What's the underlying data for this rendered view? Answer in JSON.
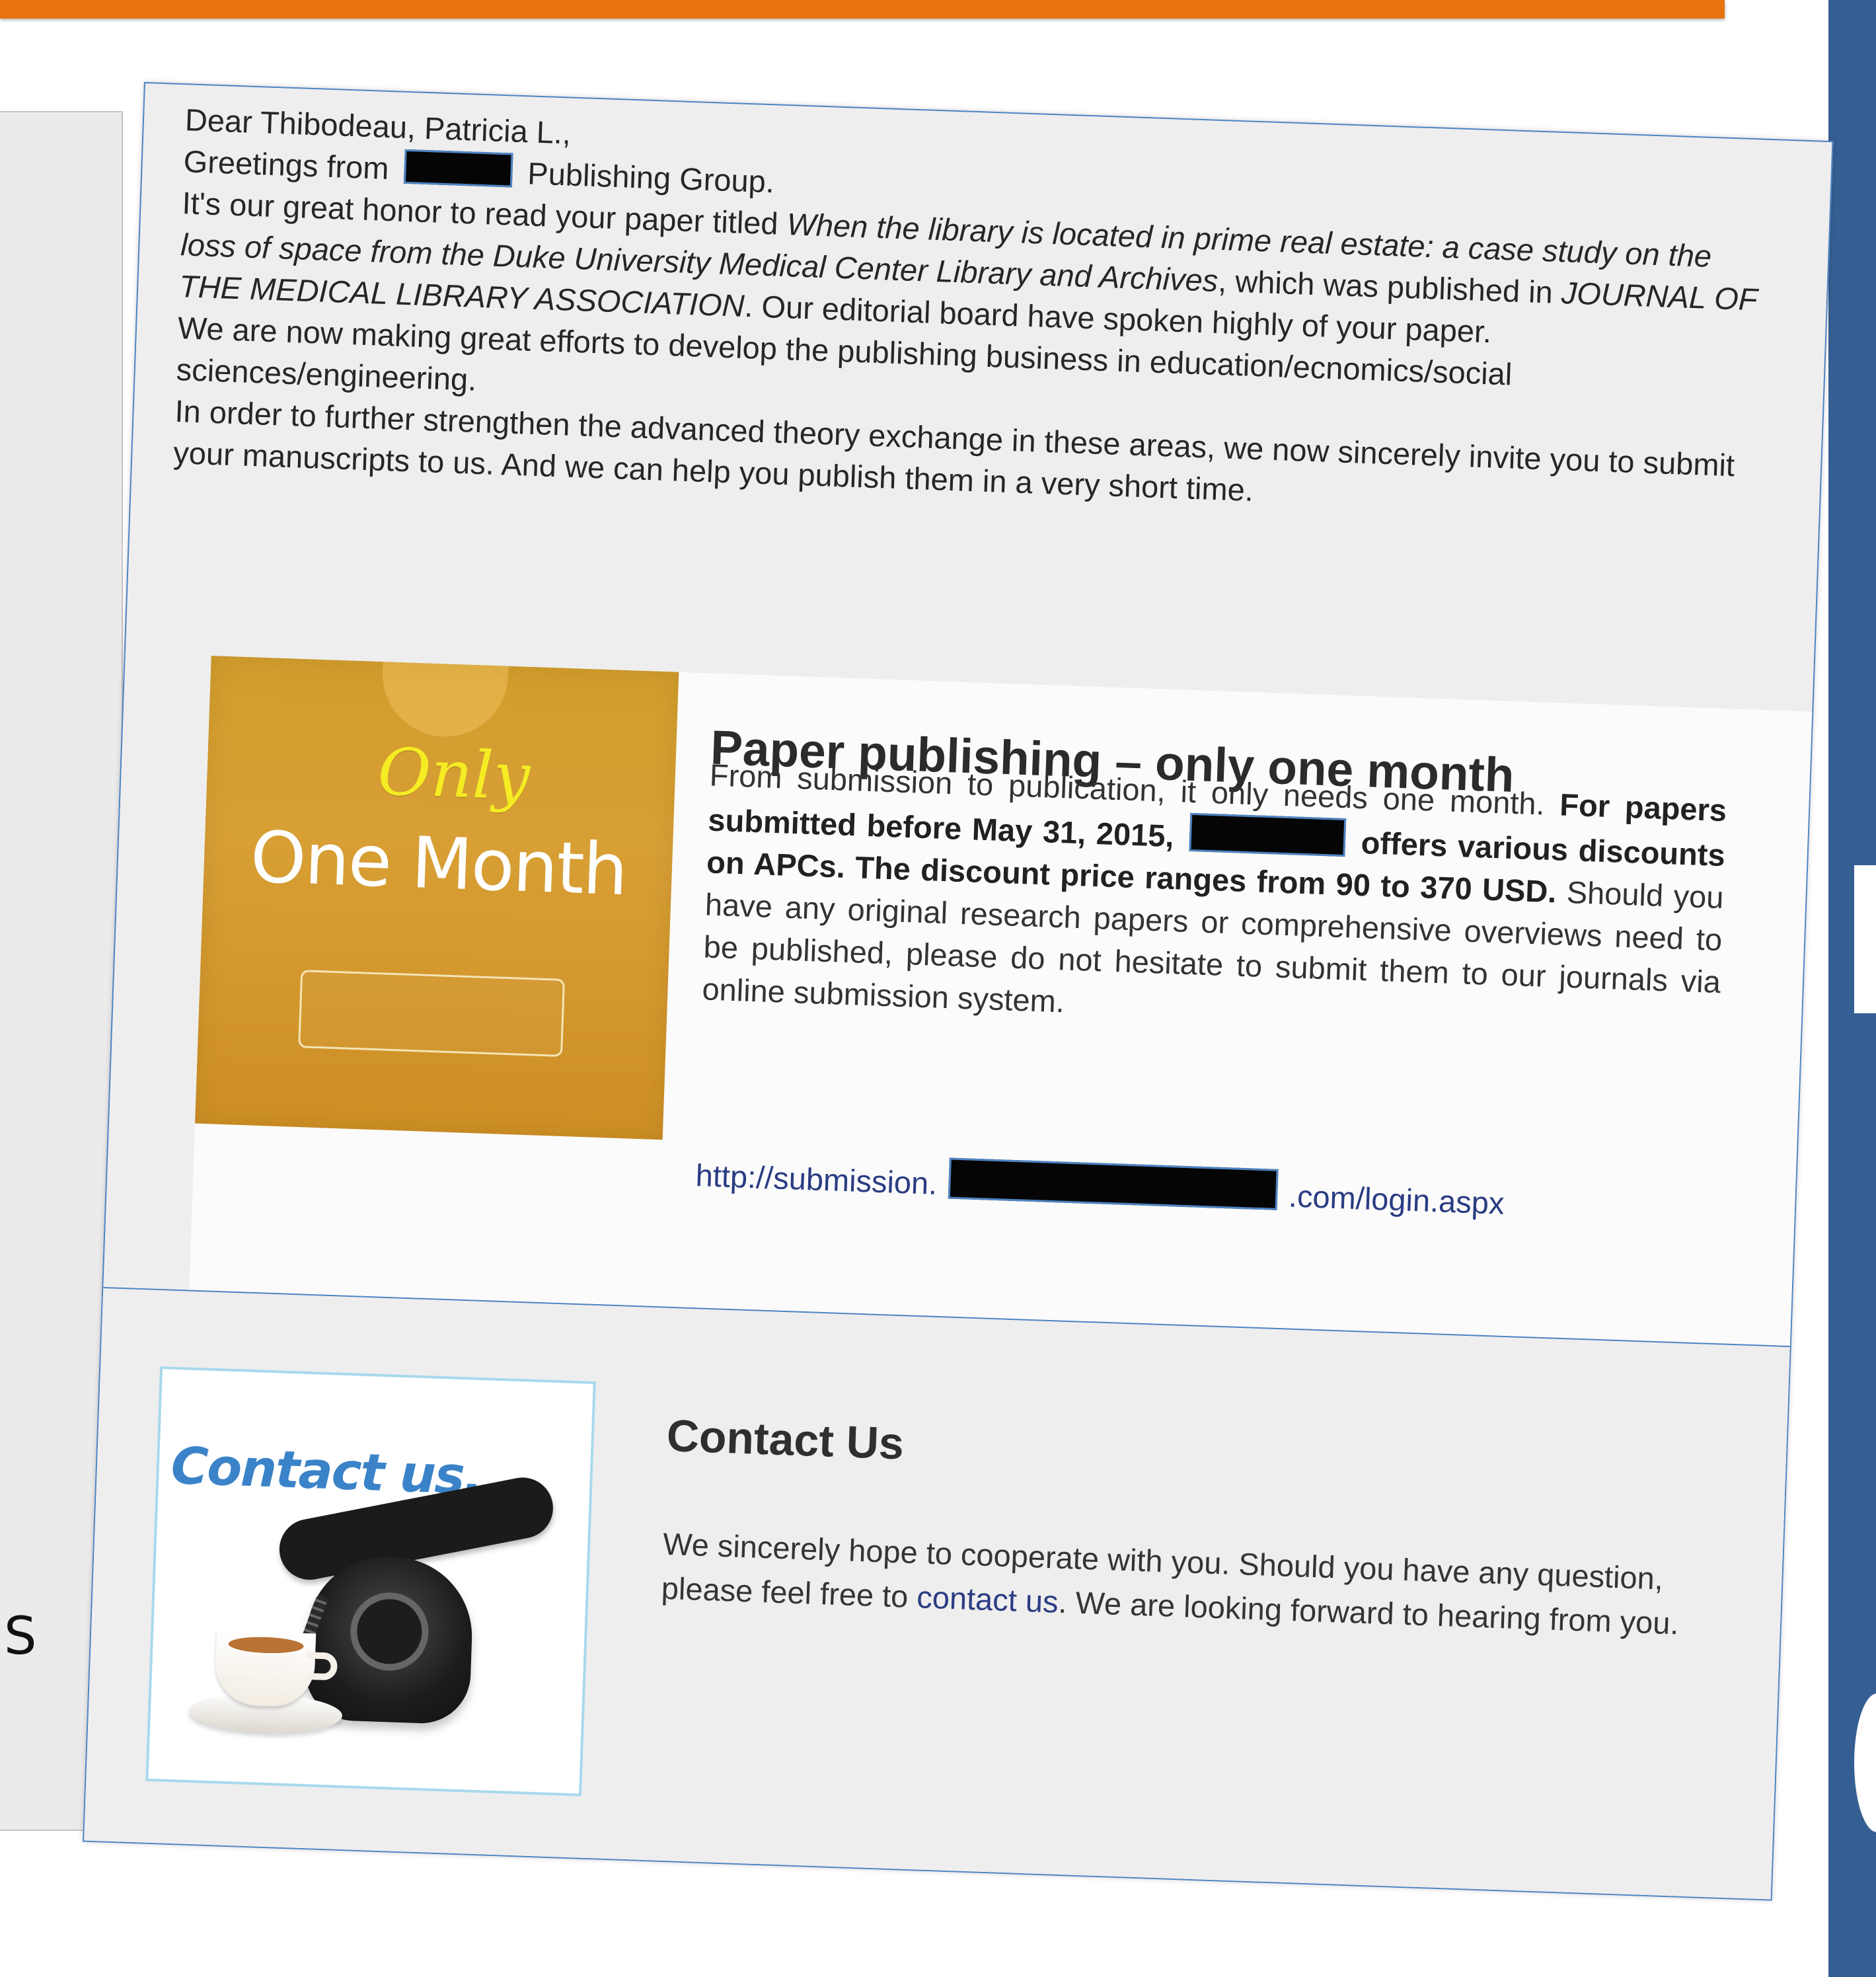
{
  "letter": {
    "greeting": "Dear Thibodeau, Patricia L.,",
    "greetings_before": "Greetings from",
    "greetings_after": "Publishing Group.",
    "honor_prefix": "It's our great honor to read your paper titled ",
    "paper_title": "When the library is located in prime real estate: a case study on the loss of space from the Duke University Medical Center Library and Archives",
    "honor_middle": ", which was published in ",
    "journal_name": "JOURNAL OF THE MEDICAL LIBRARY ASSOCIATION",
    "honor_suffix": ". Our editorial board have spoken highly of your paper.",
    "effort_text": "We are now making great efforts to develop the publishing business in education/ecnomics/social sciences/engineering.",
    "invite_text": "In order to further strengthen the advanced theory exchange in these areas, we now sincerely invite you to submit your manuscripts to us. And we can help you publish them in a very short time."
  },
  "promo": {
    "image": {
      "only": "Only",
      "month": "One Month"
    },
    "heading": "Paper publishing – only one month",
    "intro": "From submission to publication, it only needs one month.",
    "offer_prefix": "For papers submitted before May 31, 2015,",
    "offer_suffix": "offers various discounts on APCs. The discount price ranges from 90 to 370 USD.",
    "closing": "Should you have any original research papers or comprehensive overviews need to be published, please do not hesitate to submit them to our journals via online submission system.",
    "link_prefix": "http://submission.",
    "link_suffix": ".com/login.aspx"
  },
  "contact": {
    "image_banner": "Contact us...",
    "heading": "Contact Us",
    "text_before": "We sincerely hope to cooperate with you. Should you have any question, please feel free to ",
    "link_text": "contact us",
    "text_after": ". We are looking forward to hearing from you."
  },
  "background": {
    "left_fragment": "S"
  },
  "colors": {
    "top_bar": "#e8730f",
    "right_panel": "#355f92",
    "card_border": "#4f84c3",
    "link": "#2a3c82",
    "promo_gold": "#d29d2c",
    "promo_yellow": "#f5ec24"
  },
  "icons": {
    "contact_phone": "telephone-icon",
    "contact_cup": "tea-cup-icon",
    "promo_frame": "button-frame-icon"
  }
}
